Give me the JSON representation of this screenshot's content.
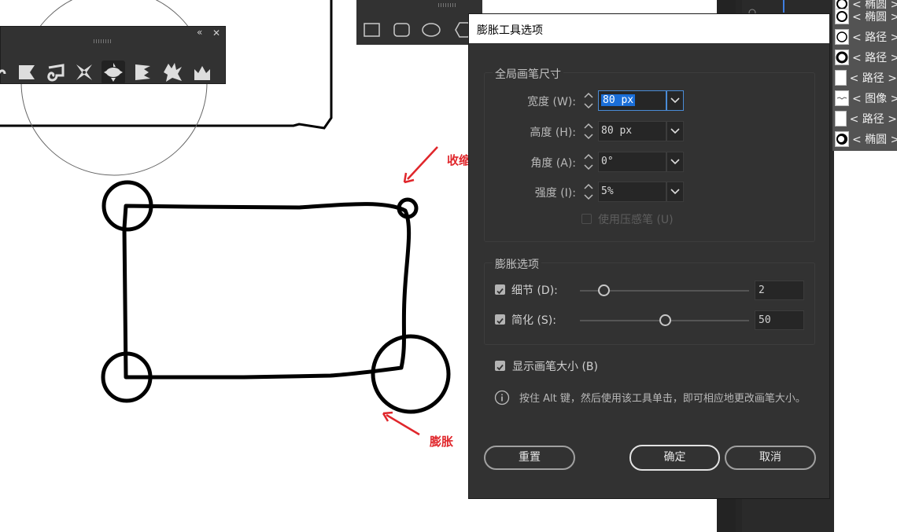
{
  "annotations": {
    "shrink": "收缩",
    "expand": "膨胀"
  },
  "shape_toolbar": {
    "grip": "||||||",
    "shapes": [
      "rectangle-shape-icon",
      "rounded-rectangle-shape-icon",
      "ellipse-shape-icon",
      "polygon-shape-icon"
    ]
  },
  "warp_toolbar": {
    "grip": "||||||",
    "collapse": "«",
    "close": "✕",
    "tools": [
      "width-icon",
      "warp-icon",
      "twirl-icon",
      "pucker-icon",
      "bloat-icon",
      "scallop-icon",
      "crystallize-icon",
      "wrinkle-icon"
    ],
    "active_tool": "bloat-icon"
  },
  "layers": {
    "rows": [
      {
        "name": "椭圆",
        "thumb": "ellipse-thumb-icon"
      },
      {
        "name": "路径",
        "thumb": "path-thumb-icon"
      },
      {
        "name": "路径",
        "thumb": "path-thumb-icon"
      },
      {
        "name": "路径",
        "thumb": "path-thumb-icon"
      },
      {
        "name": "图像",
        "thumb": "image-thumb-icon"
      },
      {
        "name": "路径",
        "thumb": "path-thumb-icon"
      },
      {
        "name": "椭圆",
        "thumb": "ellipse-thumb-icon"
      }
    ],
    "partial_top_name": "椭圆"
  },
  "dialog": {
    "title": "膨胀工具选项",
    "brush_group": {
      "legend": "全局画笔尺寸",
      "width_label": "宽度 (W):",
      "width_value": "80 px",
      "height_label": "高度 (H):",
      "height_value": "80 px",
      "angle_label": "角度 (A):",
      "angle_value": "0°",
      "intensity_label": "强度 (I):",
      "intensity_value": "5%",
      "pressure_label": "使用压感笔 (U)",
      "pressure_checked": false
    },
    "bloat_group": {
      "legend": "膨胀选项",
      "detail_label": "细节 (D):",
      "detail_checked": true,
      "detail_value": "2",
      "detail_level": 0.14,
      "simplify_label": "简化 (S):",
      "simplify_checked": true,
      "simplify_value": "50",
      "simplify_level": 0.5
    },
    "show_brush_label": "显示画笔大小 (B)",
    "show_brush_checked": true,
    "info_text": "按住 Alt 键，然后使用该工具单击，即可相应地更改画笔大小。",
    "reset_label": "重置",
    "ok_label": "确定",
    "cancel_label": "取消"
  },
  "colors": {
    "dialog_bg": "#323232",
    "accent": "#1a6ed8",
    "annotation_red": "#e0262b"
  }
}
